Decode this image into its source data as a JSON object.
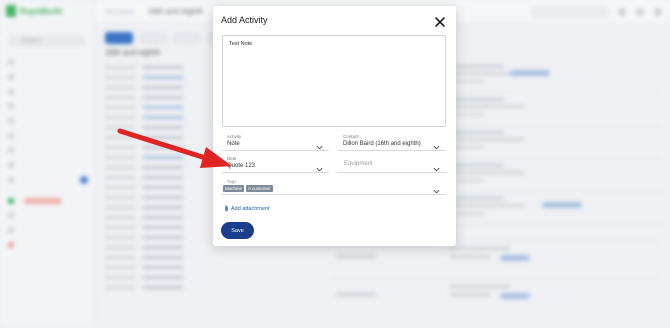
{
  "background": {
    "app_logo_text": "RapidBuild",
    "search_placeholder": "Search",
    "breadcrumb_parent": "Accounts",
    "breadcrumb_current": "16th and eighth",
    "page_heading": "16th and eighth"
  },
  "modal": {
    "title": "Add Activity",
    "note_value": "Test Note",
    "activity": {
      "label": "Activity",
      "value": "Note"
    },
    "contact": {
      "label": "Contact",
      "value": "Dillon Baird (16th and eighth)"
    },
    "deal": {
      "label": "Deal",
      "value": "Quote 123"
    },
    "equipment": {
      "placeholder": "Equipment"
    },
    "tags": {
      "label": "Tags",
      "items": [
        "Machine",
        "A customer"
      ]
    },
    "add_attachment_label": "Add attachment",
    "save_label": "Save"
  },
  "colors": {
    "primary": "#1b3f8c",
    "link": "#1f5fbf",
    "arrow": "#e02424",
    "tag": "#7f8a99"
  }
}
